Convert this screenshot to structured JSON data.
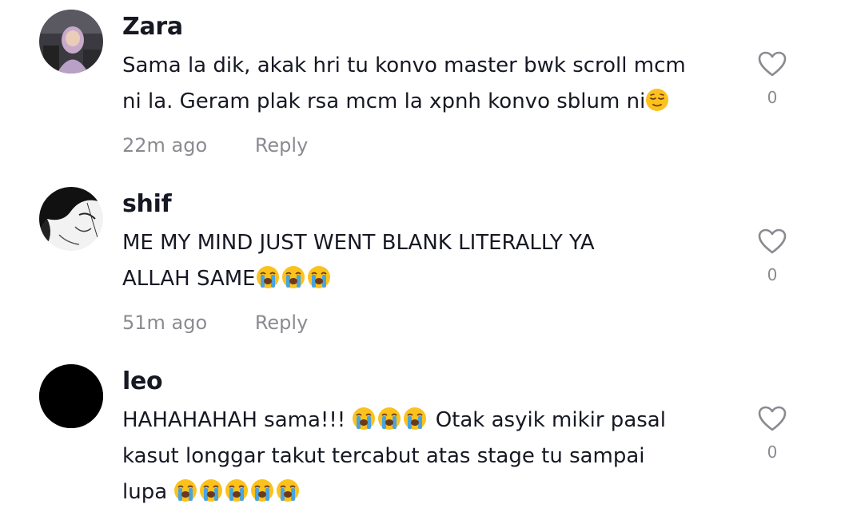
{
  "comments": [
    {
      "username": "Zara",
      "lines": [
        "Sama la dik, akak hri tu konvo master bwk scroll mcm",
        "ni la. Geram plak rsa mcm la xpnh konvo sblum ni"
      ],
      "line_emojis": [
        [],
        [
          "relieved"
        ]
      ],
      "time": "22m ago",
      "reply": "Reply",
      "likes": "0",
      "avatar": "photo-avatar"
    },
    {
      "username": "shif",
      "lines": [
        "ME MY MIND JUST WENT BLANK LITERALLY YA",
        "ALLAH SAME"
      ],
      "line_emojis": [
        [],
        [
          "loudly-crying",
          "loudly-crying",
          "loudly-crying"
        ]
      ],
      "time": "51m ago",
      "reply": "Reply",
      "likes": "0",
      "avatar": "sketch-avatar"
    },
    {
      "username": "leo",
      "lines": [
        "HAHAHAHAH sama!!! ",
        "kasut longgar takut tercabut atas stage tu sampai",
        "lupa "
      ],
      "line1_tail": " Otak asyik mikir pasal",
      "line_emojis": [
        [
          "loudly-crying",
          "loudly-crying",
          "loudly-crying"
        ],
        [],
        [
          "loudly-crying",
          "loudly-crying",
          "loudly-crying",
          "loudly-crying",
          "loudly-crying"
        ]
      ],
      "likes": "0",
      "avatar": "black-avatar"
    }
  ],
  "colors": {
    "text": "#161823",
    "muted": "#8a8b91",
    "background": "#ffffff"
  }
}
